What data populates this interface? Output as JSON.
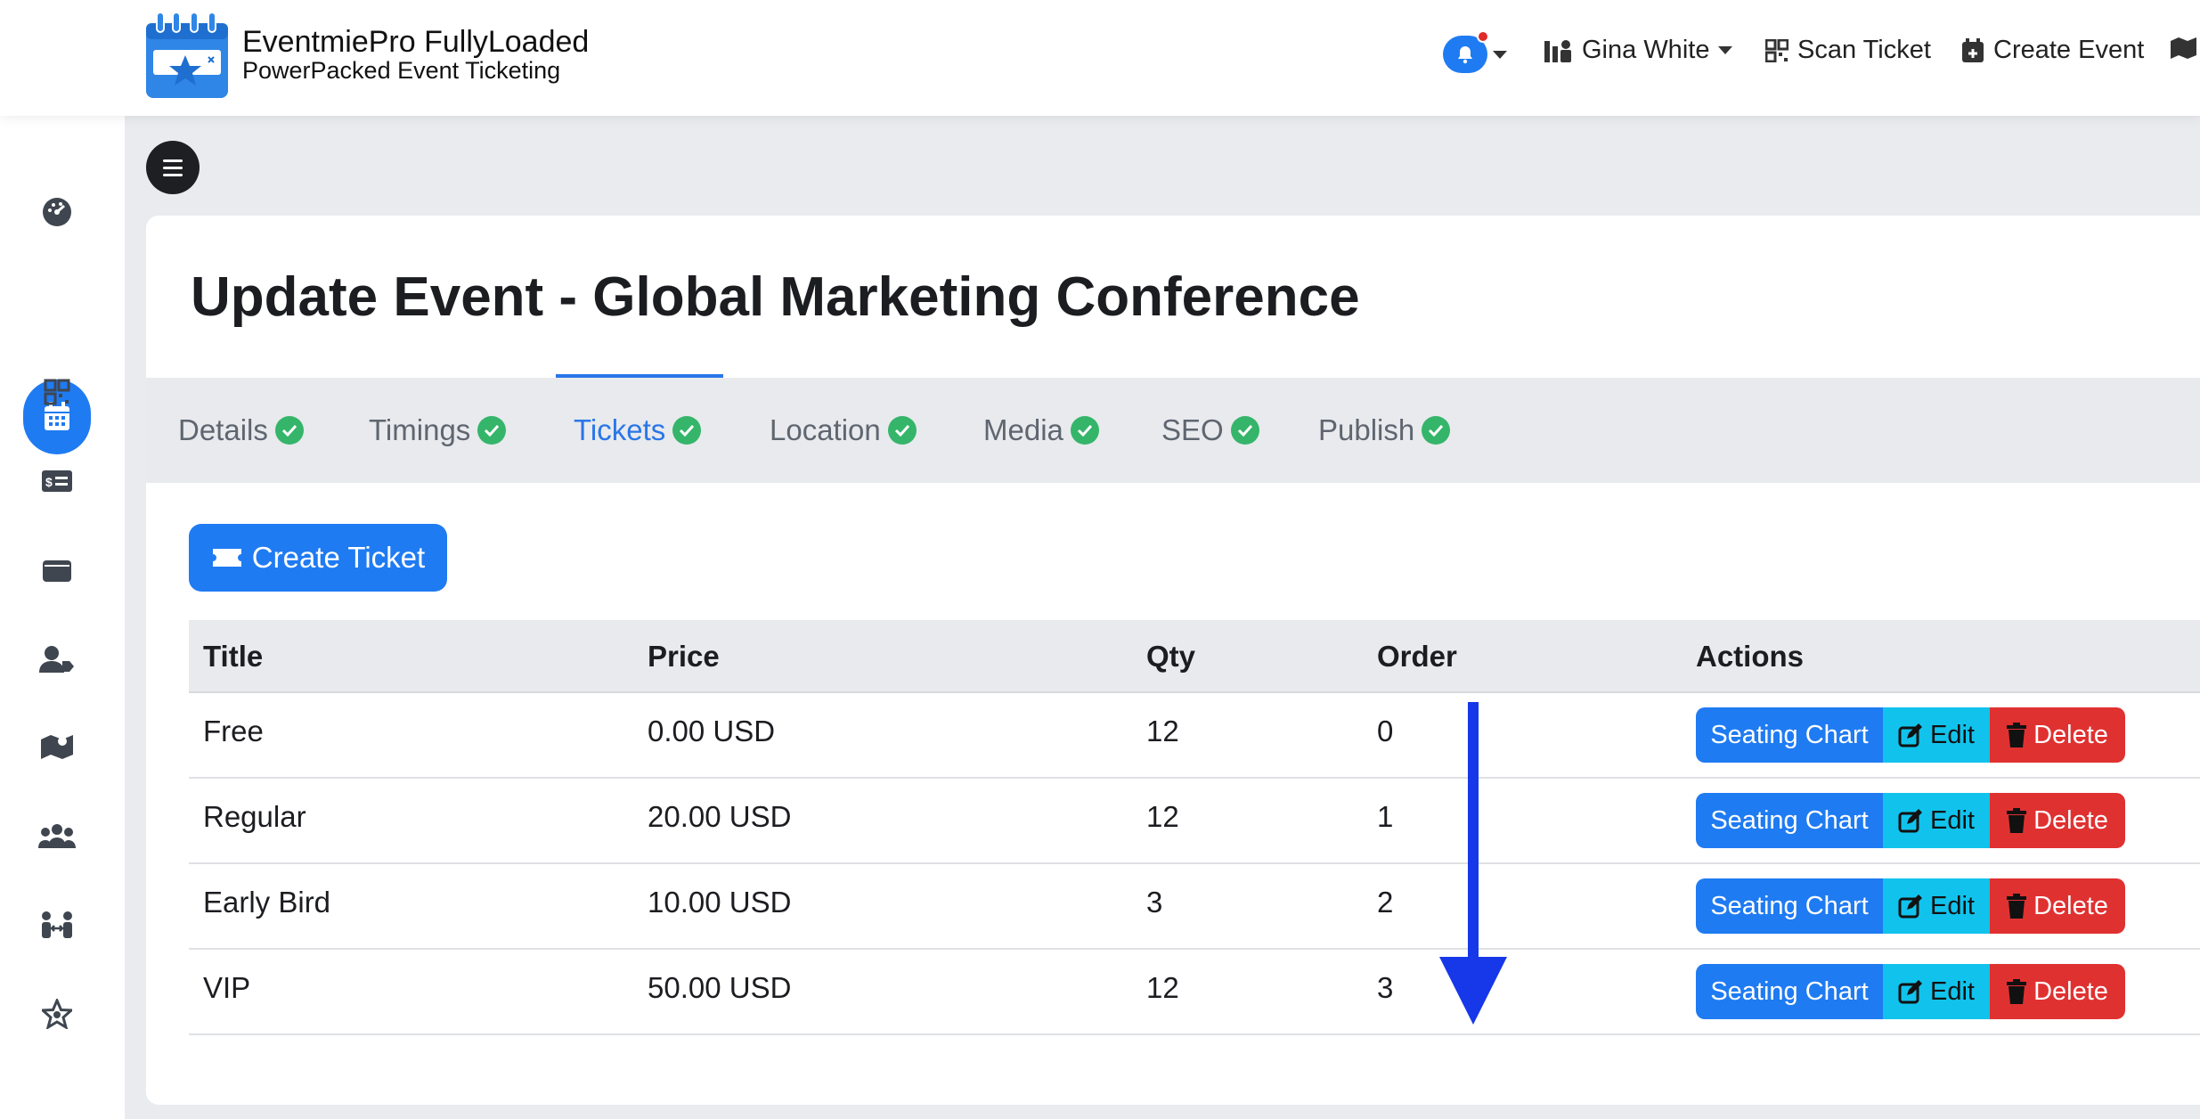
{
  "brand": {
    "title": "EventmiePro FullyLoaded",
    "subtitle": "PowerPacked Event Ticketing"
  },
  "topnav": {
    "user_name": "Gina White",
    "scan_ticket": "Scan Ticket",
    "create_event": "Create Event"
  },
  "sidebar": {
    "items": [
      "dashboard-icon",
      "calendar-icon",
      "qrcode-icon",
      "money-check-icon",
      "wallet-icon",
      "user-tag-icon",
      "map-icon",
      "users-icon",
      "people-arrows-icon",
      "star-icon"
    ],
    "active_index": 1
  },
  "page": {
    "title": "Update Event - Global Marketing Conference"
  },
  "tabs": [
    {
      "label": "Details"
    },
    {
      "label": "Timings"
    },
    {
      "label": "Tickets"
    },
    {
      "label": "Location"
    },
    {
      "label": "Media"
    },
    {
      "label": "SEO"
    },
    {
      "label": "Publish"
    }
  ],
  "active_tab": "Tickets",
  "create_ticket_label": "Create Ticket",
  "table": {
    "headers": {
      "title": "Title",
      "price": "Price",
      "qty": "Qty",
      "order": "Order",
      "actions": "Actions"
    },
    "rows": [
      {
        "title": "Free",
        "price": "0.00 USD",
        "qty": "12",
        "order": "0"
      },
      {
        "title": "Regular",
        "price": "20.00 USD",
        "qty": "12",
        "order": "1"
      },
      {
        "title": "Early Bird",
        "price": "10.00 USD",
        "qty": "3",
        "order": "2"
      },
      {
        "title": "VIP",
        "price": "50.00 USD",
        "qty": "12",
        "order": "3"
      }
    ],
    "actions": {
      "seating": "Seating Chart",
      "edit": "Edit",
      "delete": "Delete"
    }
  },
  "colors": {
    "primary": "#1f7bf2",
    "info": "#11c3ec",
    "danger": "#e03131",
    "success": "#35b56a",
    "annotation_arrow": "#1638e8"
  }
}
